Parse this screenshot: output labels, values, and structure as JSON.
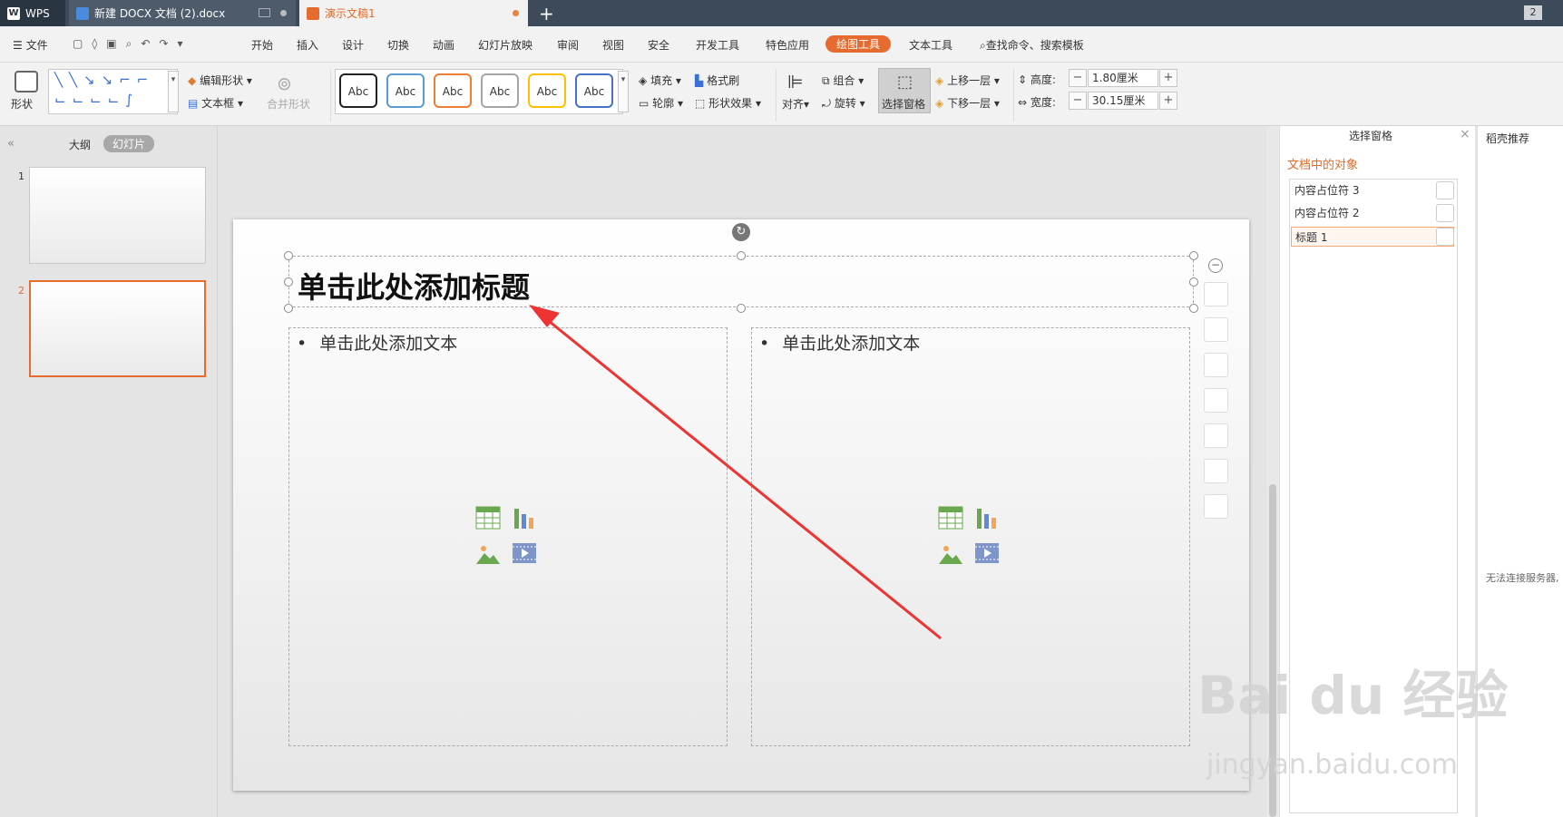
{
  "tabs": {
    "wps": "WPS",
    "doc": "新建 DOCX 文档 (2).docx",
    "ppt": "演示文稿1",
    "new_tab": "+",
    "window_count": "2"
  },
  "menu": {
    "file": "文件",
    "items": [
      "开始",
      "插入",
      "设计",
      "切换",
      "动画",
      "幻灯片放映",
      "审阅",
      "视图",
      "安全",
      "开发工具",
      "特色应用",
      "绘图工具",
      "文本工具"
    ],
    "search": "查找命令、搜索模板"
  },
  "ribbon": {
    "shape": "形状",
    "edit_shape": "编辑形状",
    "textbox": "文本框",
    "merge_shape": "合并形状",
    "abc": "Abc",
    "fill": "填充",
    "outline": "轮廓",
    "format_painter": "格式刷",
    "shape_effect": "形状效果",
    "align": "对齐",
    "group": "组合",
    "rotate": "旋转",
    "select_pane": "选择窗格",
    "bring_forward": "上移一层",
    "send_backward": "下移一层",
    "height_label": "高度:",
    "height_value": "1.80厘米",
    "width_label": "宽度:",
    "width_value": "30.15厘米"
  },
  "left_pane": {
    "outline_tab": "大纲",
    "slides_tab": "幻灯片",
    "slides": [
      "1",
      "2"
    ]
  },
  "slide": {
    "title": "单击此处添加标题",
    "left_body": "单击此处添加文本",
    "right_body": "单击此处添加文本"
  },
  "selection_pane": {
    "title": "选择窗格",
    "section": "文档中的对象",
    "objects": [
      "内容占位符 3",
      "内容占位符 2",
      "标题 1"
    ]
  },
  "recommend_pane": {
    "title": "稻壳推荐",
    "error": "无法连接服务器,"
  },
  "watermark": {
    "brand": "Bai du 经验",
    "url": "jingyan.baidu.com"
  },
  "colors": {
    "accent": "#e66b2e",
    "arrow": "#ee3333"
  }
}
